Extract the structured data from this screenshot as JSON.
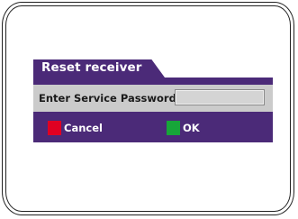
{
  "dialog": {
    "title": "Reset receiver",
    "password_label": "Enter Service Password",
    "password_value": ""
  },
  "buttons": {
    "cancel": {
      "label": "Cancel",
      "color": "#e00022"
    },
    "ok": {
      "label": "OK",
      "color": "#17a639"
    }
  },
  "colors": {
    "dialog_bg": "#4b2a78",
    "row_bg": "#cbcbcb"
  }
}
